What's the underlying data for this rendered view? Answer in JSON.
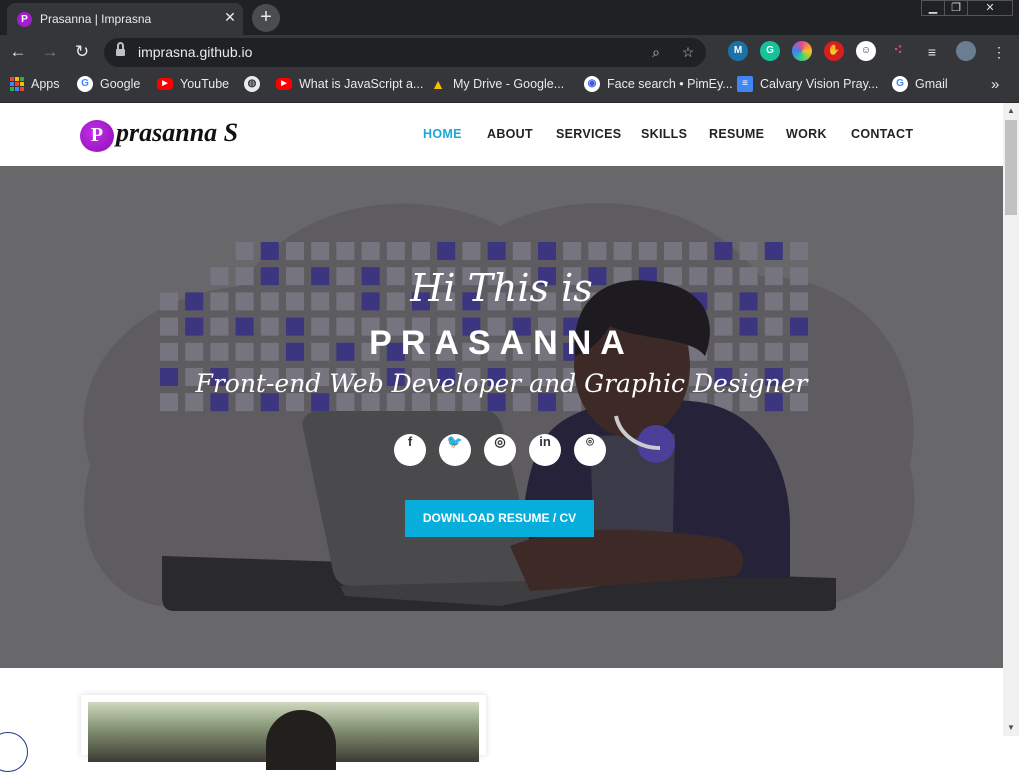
{
  "browser": {
    "tab_title": "Prasanna | Imprasna",
    "tab_close": "✕",
    "new_tab": "+",
    "url": "imprasna.github.io",
    "window_controls": [
      "▁",
      "❐",
      "✕"
    ],
    "extensions": [
      {
        "icon": "mendeley-icon",
        "label": "M",
        "color": "#1a73a8"
      },
      {
        "icon": "grammarly-icon",
        "label": "G",
        "color": "#15c39a"
      },
      {
        "icon": "color-wheel-icon",
        "label": "",
        "color": "#e94a8b"
      },
      {
        "icon": "hand-stop-icon",
        "label": "✋",
        "color": "#d61f1f"
      },
      {
        "icon": "face-icon",
        "label": "☺",
        "color": "#ffffff"
      },
      {
        "icon": "dots-icon",
        "label": "⁖",
        "color": "#d04a7a"
      }
    ]
  },
  "bookmarks": [
    {
      "label": "Apps",
      "icon": "apps-grid-icon"
    },
    {
      "label": "Google",
      "icon": "google-icon",
      "color": "#ffffff"
    },
    {
      "label": "YouTube",
      "icon": "youtube-icon",
      "color": "#ff0000"
    },
    {
      "label": "",
      "icon": "globe-icon",
      "color": "#e8eaed"
    },
    {
      "label": "What is JavaScript a...",
      "icon": "youtube-icon",
      "color": "#ff0000"
    },
    {
      "label": "My Drive - Google...",
      "icon": "drive-icon",
      "color": "#fbbc04"
    },
    {
      "label": "Face search • PimEy...",
      "icon": "pimeyes-icon",
      "color": "#3b5bdb"
    },
    {
      "label": "Calvary Vision Pray...",
      "icon": "docs-icon",
      "color": "#4285f4"
    },
    {
      "label": "Gmail",
      "icon": "google-icon",
      "color": "#ffffff"
    }
  ],
  "bookmarks_overflow": "»",
  "site": {
    "logo_letter": "P",
    "logo_text": "prasanna S",
    "menu": [
      "HOME",
      "ABOUT",
      "SERVICES",
      "SKILLS",
      "RESUME",
      "WORK",
      "CONTACT"
    ],
    "active_menu": "HOME"
  },
  "hero": {
    "greeting": "Hi This is",
    "name": "PRASANNA",
    "subtitle": "Front-end Web Developer and Graphic Designer",
    "socials": [
      {
        "icon": "facebook-icon",
        "glyph": "f"
      },
      {
        "icon": "twitter-icon",
        "glyph": "🐦"
      },
      {
        "icon": "instagram-icon",
        "glyph": "◎"
      },
      {
        "icon": "linkedin-icon",
        "glyph": "in"
      },
      {
        "icon": "github-icon",
        "glyph": "⌾"
      }
    ],
    "cta": "DOWNLOAD RESUME / CV"
  },
  "colors": {
    "accent": "#1ba8d8",
    "button": "#08aedb",
    "hero_bg": "#686769",
    "square_dark": "#3c3680",
    "square_light": "#76747f"
  }
}
